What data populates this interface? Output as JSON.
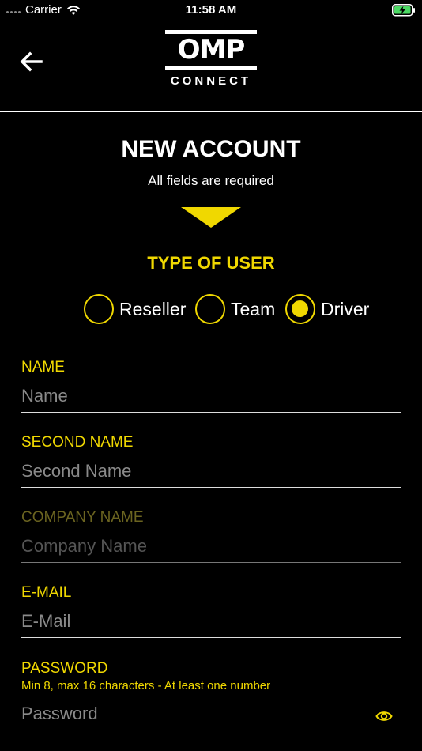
{
  "status_bar": {
    "carrier": "Carrier",
    "time": "11:58 AM",
    "icons": [
      "signal-dots-icon",
      "wifi-icon",
      "battery-charging-icon"
    ]
  },
  "header": {
    "back_icon": "arrow-left-icon",
    "logo_text": "OMP",
    "logo_subtext": "CONNECT"
  },
  "form": {
    "title": "NEW ACCOUNT",
    "subtitle": "All fields are required",
    "user_type": {
      "title": "TYPE OF USER",
      "options": [
        {
          "label": "Reseller",
          "selected": false
        },
        {
          "label": "Team",
          "selected": false
        },
        {
          "label": "Driver",
          "selected": true
        }
      ]
    },
    "fields": {
      "name": {
        "label": "NAME",
        "placeholder": "Name"
      },
      "second_name": {
        "label": "SECOND NAME",
        "placeholder": "Second Name"
      },
      "company_name": {
        "label": "COMPANY NAME",
        "placeholder": "Company Name",
        "disabled": true
      },
      "email": {
        "label": "E-MAIL",
        "placeholder": "E-Mail"
      },
      "password": {
        "label": "PASSWORD",
        "hint": "Min 8, max 16 characters - At least one number",
        "placeholder": "Password",
        "icon": "eye-icon"
      }
    }
  },
  "colors": {
    "accent": "#f0d800",
    "background": "#000000",
    "text": "#ffffff"
  }
}
